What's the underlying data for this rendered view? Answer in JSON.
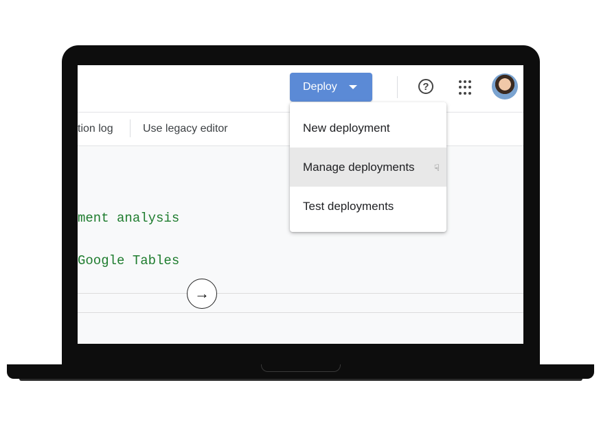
{
  "header": {
    "deploy_label": "Deploy",
    "icons": [
      "help-circle-icon",
      "apps-grid-icon",
      "account-avatar"
    ]
  },
  "toolbar": {
    "execution_log_label": "tion log",
    "legacy_editor_label": "Use legacy editor"
  },
  "deploy_menu": {
    "items": [
      {
        "label": "New deployment"
      },
      {
        "label": "Manage deployments",
        "hovered": true
      },
      {
        "label": "Test deployments"
      }
    ]
  },
  "editor": {
    "lines": [
      "ment analysis",
      "Google Tables"
    ]
  },
  "colors": {
    "deploy_button": "#5b8ad6",
    "code_text": "#1e7c2e",
    "menu_hover": "#e8e8e8"
  }
}
